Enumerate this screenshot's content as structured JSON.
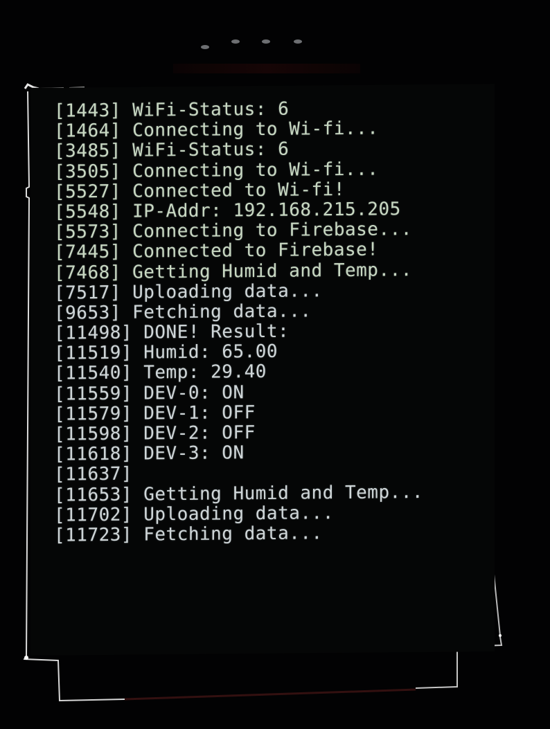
{
  "colors": {
    "background": "#020203",
    "screen": "#050606",
    "text": "#cfd6d8",
    "bezel_edge": "#d9d9d9"
  },
  "log": [
    {
      "time": "[1443]",
      "message": "WiFi-Status: 6"
    },
    {
      "time": "[1464]",
      "message": "Connecting to Wi-fi..."
    },
    {
      "time": "[3485]",
      "message": "WiFi-Status: 6"
    },
    {
      "time": "[3505]",
      "message": "Connecting to Wi-fi..."
    },
    {
      "time": "[5527]",
      "message": "Connected to Wi-fi!"
    },
    {
      "time": "[5548]",
      "message": "IP-Addr: 192.168.215.205"
    },
    {
      "time": "[5573]",
      "message": "Connecting to Firebase..."
    },
    {
      "time": "[7445]",
      "message": "Connected to Firebase!"
    },
    {
      "time": "[7468]",
      "message": "Getting Humid and Temp..."
    },
    {
      "time": "[7517]",
      "message": "Uploading data..."
    },
    {
      "time": "[9653]",
      "message": "Fetching data..."
    },
    {
      "time": "[11498]",
      "message": "DONE! Result:"
    },
    {
      "time": "[11519]",
      "message": "Humid: 65.00"
    },
    {
      "time": "[11540]",
      "message": "Temp: 29.40"
    },
    {
      "time": "[11559]",
      "message": "DEV-0: ON"
    },
    {
      "time": "[11579]",
      "message": "DEV-1: OFF"
    },
    {
      "time": "[11598]",
      "message": "DEV-2: OFF"
    },
    {
      "time": "[11618]",
      "message": "DEV-3: ON"
    },
    {
      "time": "[11637]",
      "message": ""
    },
    {
      "time": "[11653]",
      "message": "Getting Humid and Temp..."
    },
    {
      "time": "[11702]",
      "message": "Uploading data..."
    },
    {
      "time": "[11723]",
      "message": "Fetching data..."
    }
  ]
}
